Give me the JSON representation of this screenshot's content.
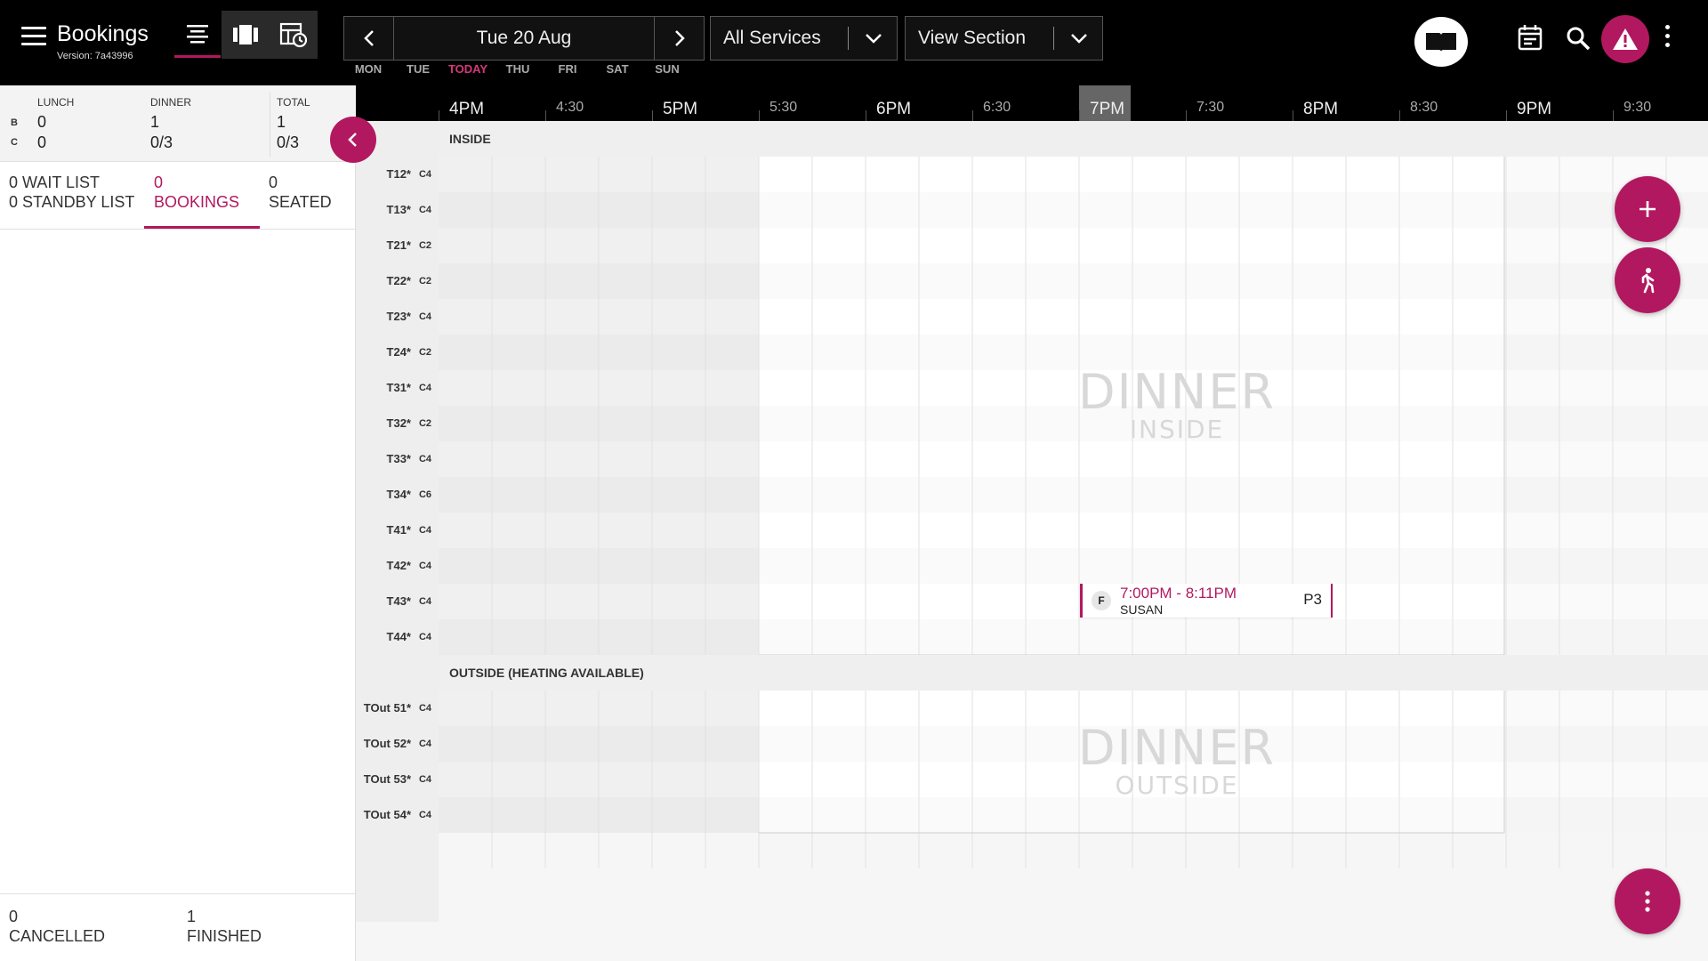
{
  "header": {
    "title": "Bookings",
    "version": "Version: 7a43996",
    "date_label": "Tue 20 Aug",
    "days": [
      "MON",
      "TUE",
      "TODAY",
      "THU",
      "FRI",
      "SAT",
      "SUN"
    ],
    "services_label": "All Services",
    "section_label": "View Section",
    "accent": "#b2185f"
  },
  "summary": {
    "headers": [
      "LUNCH",
      "DINNER",
      "TOTAL"
    ],
    "row_labels": [
      "B",
      "C"
    ],
    "lunch": [
      "0",
      "0"
    ],
    "dinner": [
      "1",
      "0/3"
    ],
    "total": [
      "1",
      "0/3"
    ]
  },
  "lists": {
    "wait": "0 WAIT LIST",
    "standby": "0 STANDBY LIST",
    "bookings_count": "0",
    "bookings_label": "BOOKINGS",
    "seated_count": "0",
    "seated_label": "SEATED"
  },
  "footer": {
    "cancelled_count": "0",
    "cancelled_label": "CANCELLED",
    "finished_count": "1",
    "finished_label": "FINISHED"
  },
  "timeline": {
    "hours": [
      "4PM",
      "4:30",
      "5PM",
      "5:30",
      "6PM",
      "6:30",
      "7PM",
      "7:30",
      "8PM",
      "8:30",
      "9PM",
      "9:30"
    ],
    "current_hour": "7PM"
  },
  "sections": [
    {
      "name": "INSIDE",
      "watermark": "DINNER",
      "watermark_sub": "INSIDE",
      "tables": [
        {
          "name": "T12*",
          "cap": "C4"
        },
        {
          "name": "T13*",
          "cap": "C4"
        },
        {
          "name": "T21*",
          "cap": "C2"
        },
        {
          "name": "T22*",
          "cap": "C2"
        },
        {
          "name": "T23*",
          "cap": "C4"
        },
        {
          "name": "T24*",
          "cap": "C2"
        },
        {
          "name": "T31*",
          "cap": "C4"
        },
        {
          "name": "T32*",
          "cap": "C2"
        },
        {
          "name": "T33*",
          "cap": "C4"
        },
        {
          "name": "T34*",
          "cap": "C6"
        },
        {
          "name": "T41*",
          "cap": "C4"
        },
        {
          "name": "T42*",
          "cap": "C4"
        },
        {
          "name": "T43*",
          "cap": "C4"
        },
        {
          "name": "T44*",
          "cap": "C4"
        }
      ]
    },
    {
      "name": "OUTSIDE (HEATING AVAILABLE)",
      "watermark": "DINNER",
      "watermark_sub": "OUTSIDE",
      "tables": [
        {
          "name": "TOut 51*",
          "cap": "C4"
        },
        {
          "name": "TOut 52*",
          "cap": "C4"
        },
        {
          "name": "TOut 53*",
          "cap": "C4"
        },
        {
          "name": "TOut 54*",
          "cap": "C4"
        }
      ]
    }
  ],
  "booking": {
    "status": "F",
    "time": "7:00PM - 8:11PM",
    "name": "SUSAN",
    "party": "P3",
    "table": "T43*"
  }
}
